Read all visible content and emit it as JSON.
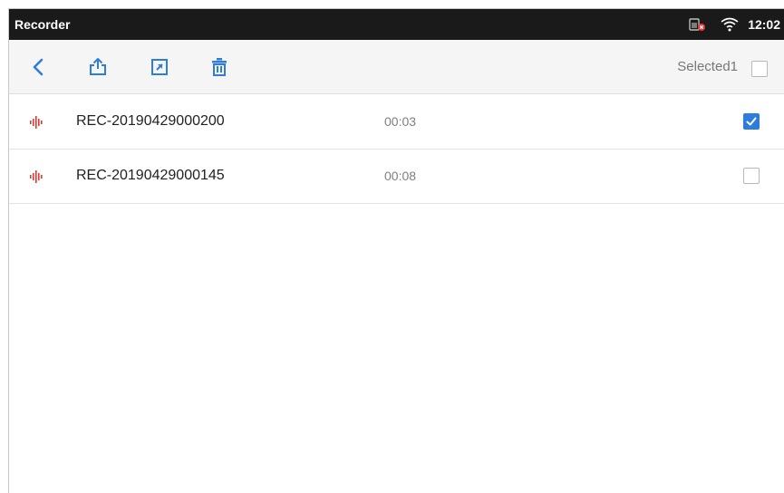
{
  "status_bar": {
    "title": "Recorder",
    "time": "12:02",
    "icons": [
      "sim-error-icon",
      "wifi-icon"
    ]
  },
  "toolbar": {
    "icons": [
      "back-icon",
      "share-icon",
      "open-external-icon",
      "delete-icon"
    ],
    "selected_label": "Selected1",
    "select_all_checked": false
  },
  "recordings": [
    {
      "name": "REC-20190429000200",
      "duration": "00:03",
      "checked": true
    },
    {
      "name": "REC-20190429000145",
      "duration": "00:08",
      "checked": false
    }
  ],
  "colors": {
    "accent": "#2f7ddb",
    "record_icon": "#e53935",
    "status_bar": "#1a1a1a",
    "toolbar": "#f5f5f5"
  }
}
